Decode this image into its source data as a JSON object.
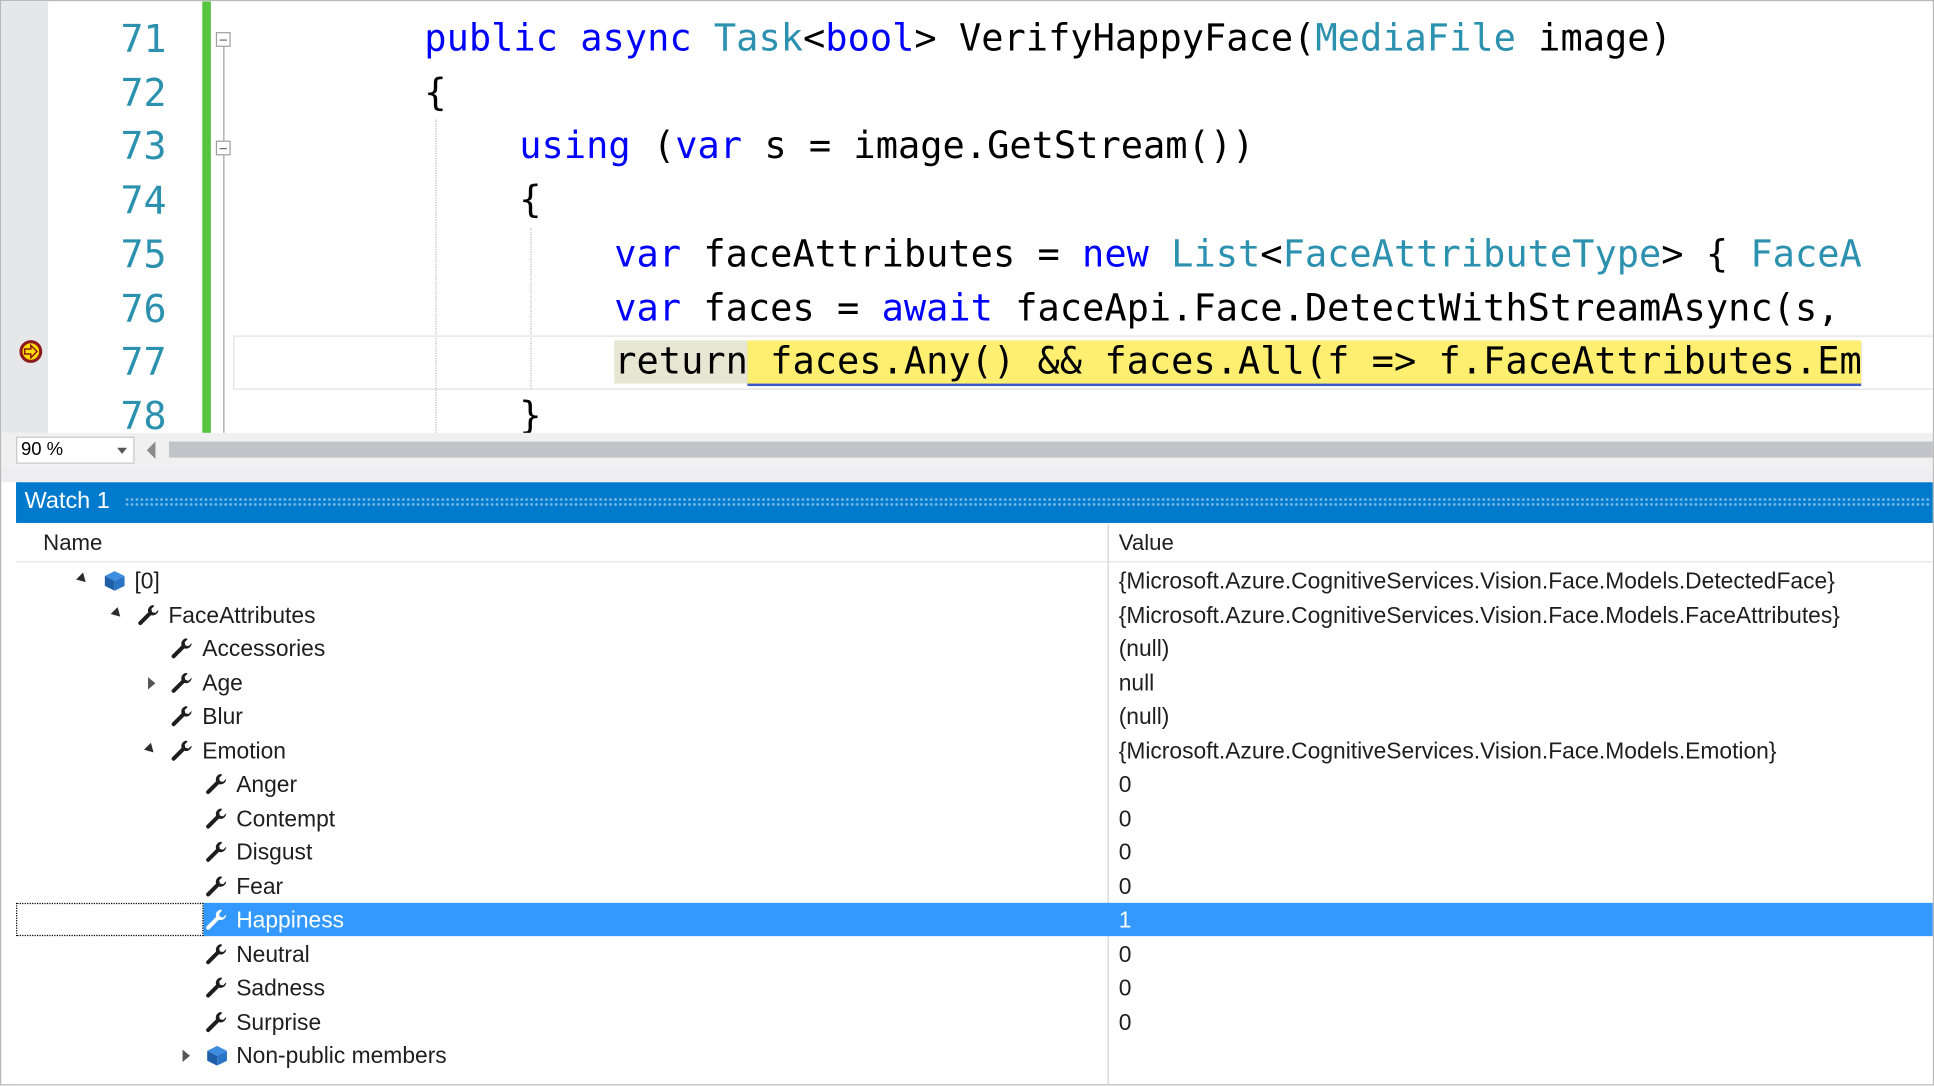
{
  "editor": {
    "line_numbers": [
      "71",
      "72",
      "73",
      "74",
      "75",
      "76",
      "77",
      "78"
    ],
    "lines": [
      [
        {
          "t": "public",
          "c": "kw"
        },
        {
          "t": " "
        },
        {
          "t": "async",
          "c": "kw"
        },
        {
          "t": " "
        },
        {
          "t": "Task",
          "c": "ty"
        },
        {
          "t": "<"
        },
        {
          "t": "bool",
          "c": "kw"
        },
        {
          "t": "> VerifyHappyFace("
        },
        {
          "t": "MediaFile",
          "c": "ty"
        },
        {
          "t": " image)"
        }
      ],
      [
        {
          "t": "{"
        }
      ],
      [
        {
          "t": "using",
          "c": "kw"
        },
        {
          "t": " ("
        },
        {
          "t": "var",
          "c": "kw"
        },
        {
          "t": " s = image.GetStream())"
        }
      ],
      [
        {
          "t": "{"
        }
      ],
      [
        {
          "t": "var",
          "c": "kw"
        },
        {
          "t": " faceAttributes = "
        },
        {
          "t": "new",
          "c": "kw"
        },
        {
          "t": " "
        },
        {
          "t": "List",
          "c": "ty"
        },
        {
          "t": "<"
        },
        {
          "t": "FaceAttributeType",
          "c": "ty"
        },
        {
          "t": "> { "
        },
        {
          "t": "FaceA",
          "c": "ty"
        }
      ],
      [
        {
          "t": "var",
          "c": "kw"
        },
        {
          "t": " faces = "
        },
        {
          "t": "await",
          "c": "kw"
        },
        {
          "t": " faceApi.Face.DetectWithStreamAsync(s,"
        }
      ],
      [
        {
          "t": "return",
          "c": "ret"
        },
        {
          "t": " faces.Any() && faces.All(f => f.FaceAttributes.Em",
          "c": "hl"
        }
      ],
      [
        {
          "t": "}"
        }
      ]
    ],
    "zoom": "90 %"
  },
  "watch": {
    "title": "Watch 1",
    "columns": {
      "name": "Name",
      "value": "Value"
    },
    "rows": [
      {
        "name": "[0]",
        "value": "{Microsoft.Azure.CognitiveServices.Vision.Face.Models.DetectedFace}",
        "icon": "object-icon",
        "depth": 0,
        "expander": "open"
      },
      {
        "name": "FaceAttributes",
        "value": "{Microsoft.Azure.CognitiveServices.Vision.Face.Models.FaceAttributes}",
        "icon": "wrench-icon",
        "depth": 1,
        "expander": "open"
      },
      {
        "name": "Accessories",
        "value": "(null)",
        "icon": "wrench-icon",
        "depth": 2,
        "expander": "none"
      },
      {
        "name": "Age",
        "value": "null",
        "icon": "wrench-icon",
        "depth": 2,
        "expander": "closed"
      },
      {
        "name": "Blur",
        "value": "(null)",
        "icon": "wrench-icon",
        "depth": 2,
        "expander": "none"
      },
      {
        "name": "Emotion",
        "value": "{Microsoft.Azure.CognitiveServices.Vision.Face.Models.Emotion}",
        "icon": "wrench-icon",
        "depth": 2,
        "expander": "open"
      },
      {
        "name": "Anger",
        "value": "0",
        "icon": "wrench-icon",
        "depth": 3,
        "expander": "none"
      },
      {
        "name": "Contempt",
        "value": "0",
        "icon": "wrench-icon",
        "depth": 3,
        "expander": "none"
      },
      {
        "name": "Disgust",
        "value": "0",
        "icon": "wrench-icon",
        "depth": 3,
        "expander": "none"
      },
      {
        "name": "Fear",
        "value": "0",
        "icon": "wrench-icon",
        "depth": 3,
        "expander": "none"
      },
      {
        "name": "Happiness",
        "value": "1",
        "icon": "wrench-icon",
        "depth": 3,
        "expander": "none",
        "selected": true
      },
      {
        "name": "Neutral",
        "value": "0",
        "icon": "wrench-icon",
        "depth": 3,
        "expander": "none"
      },
      {
        "name": "Sadness",
        "value": "0",
        "icon": "wrench-icon",
        "depth": 3,
        "expander": "none"
      },
      {
        "name": "Surprise",
        "value": "0",
        "icon": "wrench-icon",
        "depth": 3,
        "expander": "none"
      },
      {
        "name": "Non-public members",
        "value": "",
        "icon": "object-icon",
        "depth": 3,
        "expander": "closed"
      }
    ],
    "colors": {
      "title_bar": "#007acc",
      "selection": "#3399ff",
      "line_number": "#2b91af",
      "keyword": "#0000ff",
      "type": "#2b91af",
      "current_statement": "#ffef71",
      "changed_lines": "#57c540"
    }
  }
}
